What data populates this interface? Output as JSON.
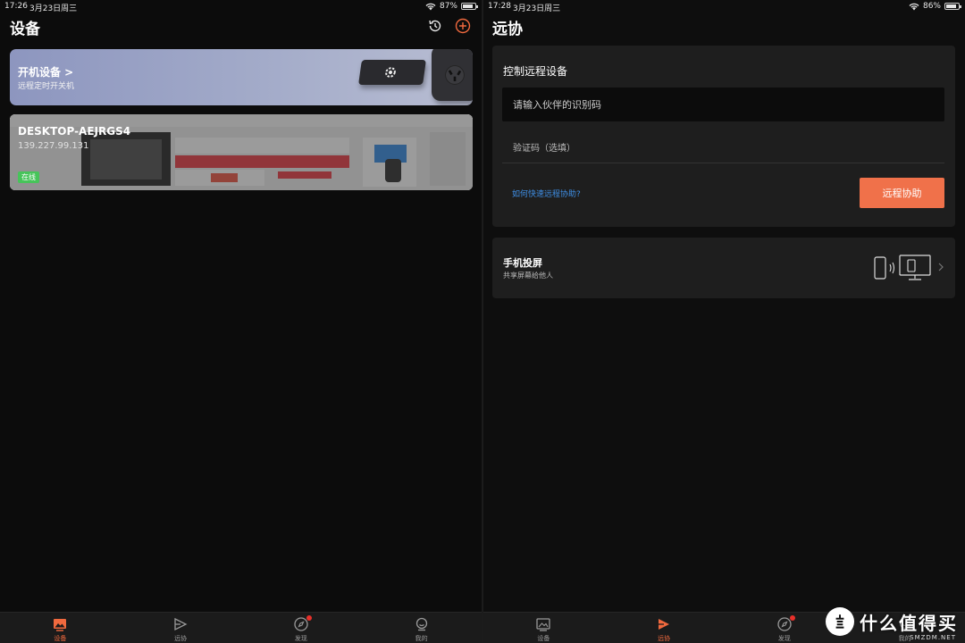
{
  "left": {
    "status": {
      "time": "17:26",
      "date": "3月23日周三",
      "battery": "87%",
      "battery_level": 0.87
    },
    "title": "设备",
    "power_card": {
      "title": "开机设备 >",
      "subtitle": "远程定时开关机"
    },
    "desktop_card": {
      "name": "DESKTOP-AEJRGS4",
      "ip": "139.227.99.131",
      "status": "在线"
    },
    "tabs": [
      {
        "label": "设备",
        "icon": "device-icon",
        "active": true
      },
      {
        "label": "远协",
        "icon": "remote-assist-icon",
        "active": false
      },
      {
        "label": "发现",
        "icon": "compass-icon",
        "active": false,
        "badge": true
      },
      {
        "label": "我的",
        "icon": "profile-icon",
        "active": false
      }
    ]
  },
  "right": {
    "status": {
      "time": "17:28",
      "date": "3月23日周三",
      "battery": "86%",
      "battery_level": 0.86
    },
    "title": "远协",
    "assist": {
      "title": "控制远程设备",
      "id_placeholder": "请输入伙伴的识别码",
      "code_placeholder": "验证码（选填）",
      "help_link": "如何快速远程协助?",
      "button_label": "远程协助"
    },
    "cast": {
      "title": "手机投屏",
      "subtitle": "共享屏幕给他人"
    },
    "tabs": [
      {
        "label": "设备",
        "icon": "device-icon",
        "active": false
      },
      {
        "label": "远协",
        "icon": "remote-assist-icon",
        "active": true
      },
      {
        "label": "发现",
        "icon": "compass-icon",
        "active": false,
        "badge": true
      },
      {
        "label": "我的",
        "icon": "profile-icon",
        "active": false
      }
    ]
  },
  "watermark": {
    "text": "什么值得买",
    "sub": "SMZDM.NET"
  },
  "colors": {
    "accent": "#f0714a",
    "active_tab": "#f0693e",
    "online": "#47c45a",
    "link": "#3f8fe6"
  }
}
